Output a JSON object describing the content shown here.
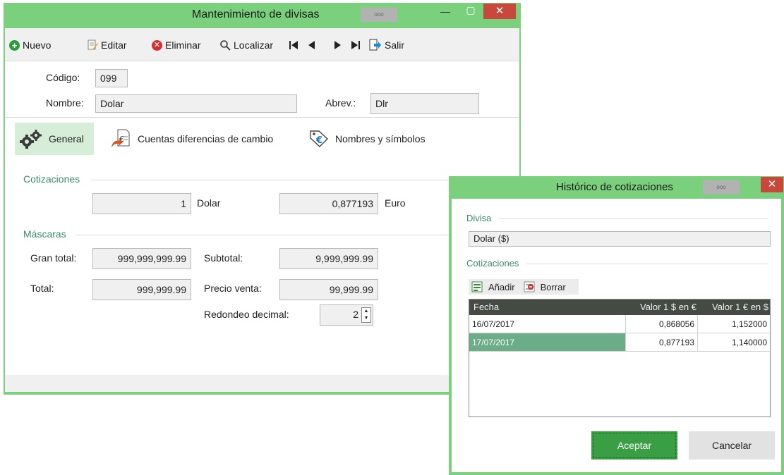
{
  "main_window": {
    "title": "Mantenimiento de divisas",
    "title_badge": "ooo",
    "toolbar": {
      "new": "Nuevo",
      "edit": "Editar",
      "delete": "Eliminar",
      "find": "Localizar",
      "exit": "Salir"
    },
    "form": {
      "code_label": "Código:",
      "code_value": "099",
      "name_label": "Nombre:",
      "name_value": "Dolar",
      "abbr_label": "Abrev.:",
      "abbr_value": "Dlr"
    },
    "tabs": [
      {
        "label": "General",
        "icon": "gears-icon"
      },
      {
        "label": "Cuentas diferencias de cambio",
        "icon": "euro-document-icon"
      },
      {
        "label": "Nombres y símbolos",
        "icon": "euro-tag-icon"
      }
    ],
    "quotes": {
      "section": "Cotizaciones",
      "amount_left": "1",
      "currency_left": "Dolar",
      "amount_right": "0,877193",
      "currency_right": "Euro"
    },
    "masks": {
      "section": "Máscaras",
      "grand_total_label": "Gran total:",
      "grand_total_value": "999,999,999.99",
      "subtotal_label": "Subtotal:",
      "subtotal_value": "9,999,999.99",
      "total_label": "Total:",
      "total_value": "999,999.99",
      "sale_price_label": "Precio venta:",
      "sale_price_value": "99,999.99",
      "rounding_label": "Redondeo decimal:",
      "rounding_value": "2"
    }
  },
  "history_window": {
    "title": "Histórico de cotizaciones",
    "title_badge": "ooo",
    "currency_section": "Divisa",
    "currency_value": "Dolar ($)",
    "quotes_section": "Cotizaciones",
    "add_label": "Añadir",
    "delete_label": "Borrar",
    "columns": [
      "Fecha",
      "Valor 1 $ en €",
      "Valor 1 € en $"
    ],
    "rows": [
      {
        "date": "16/07/2017",
        "usd_eur": "0,868056",
        "eur_usd": "1,152000",
        "selected": false
      },
      {
        "date": "17/07/2017",
        "usd_eur": "0,877193",
        "eur_usd": "1,140000",
        "selected": true
      }
    ],
    "accept": "Aceptar",
    "cancel": "Cancelar"
  },
  "colors": {
    "frame": "#7ad07d",
    "accent": "#3a9e44",
    "section_text": "#3c8a6a",
    "selected_row": "#6aad88"
  }
}
